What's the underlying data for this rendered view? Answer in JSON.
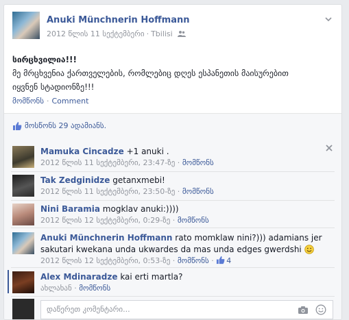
{
  "post": {
    "author": "Anuki Münchnerin Hoffmann",
    "date": "2012 წლის 11 სექტემბერი",
    "location": "Tbilisi",
    "line1": "სირცხვილია!!!",
    "line2": "მე მრცხვენია ქართველების, რომლებიც დღეს ესპანეთის მაისურებით",
    "line3": "იყვნენ სტადიონზე!!!",
    "like_label": "მომწონს",
    "comment_label": "Comment",
    "likes_text": "მოსწონს 29 ადამიანს."
  },
  "comments": [
    {
      "name": "Mamuka Cincadze",
      "text": "+1 anuki .",
      "date": "2012 წლის 11 სექტემბერი, 23:47-ზე",
      "like": "მომწონს"
    },
    {
      "name": "Tak Zedginidze",
      "text": "getanxmebi!",
      "date": "2012 წლის 11 სექტემბერი, 23:50-ზე",
      "like": "მომწონს"
    },
    {
      "name": "Nini Baramia",
      "text": "mogklav anuki:))))",
      "date": "2012 წლის 12 სექტემბერი, 0:29-ზე",
      "like": "მომწონს"
    },
    {
      "name": "Anuki Münchnerin Hoffmann",
      "text": "rato momklaw nini?))) adamians jer sakutari kwekana unda ukwardes da mas unda edges gwerdshi",
      "date": "2012 წლის 12 სექტემბერი, 0:53-ზე",
      "like": "მომწონს",
      "like_count": "4"
    },
    {
      "name": "Alex Mdinaradze",
      "text": "kai erti martla?",
      "action1": "ახლახან",
      "like": "მომწონს"
    }
  ],
  "composer": {
    "placeholder": "დაწერეთ კომენტარი..."
  },
  "colors": {
    "link": "#3b5998",
    "meta": "#90949c",
    "bg": "#f6f7f9"
  }
}
